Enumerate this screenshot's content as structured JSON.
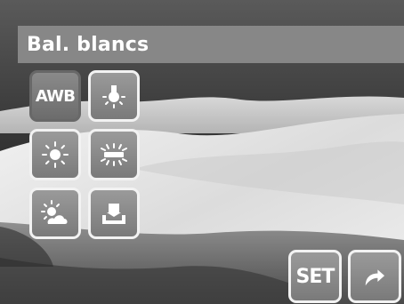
{
  "title": "Bal. blancs",
  "wb_modes": [
    {
      "id": "awb",
      "label": "AWB",
      "icon": "awb-text",
      "selected": true
    },
    {
      "id": "tungsten",
      "icon": "tungsten-bulb-icon",
      "selected": false
    },
    {
      "id": "daylight",
      "icon": "sun-icon",
      "selected": false
    },
    {
      "id": "fluorescent",
      "icon": "fluorescent-tube-icon",
      "selected": false
    },
    {
      "id": "cloudy",
      "icon": "sun-cloud-icon",
      "selected": false
    },
    {
      "id": "custom",
      "icon": "custom-wb-icon",
      "selected": false
    }
  ],
  "actions": {
    "set_label": "SET",
    "return_icon": "return-arrow-icon"
  },
  "colors": {
    "title_bar": "#8c8c8c",
    "button_border": "#f2f2f2",
    "selected_border": "#686868",
    "text": "#ffffff"
  }
}
